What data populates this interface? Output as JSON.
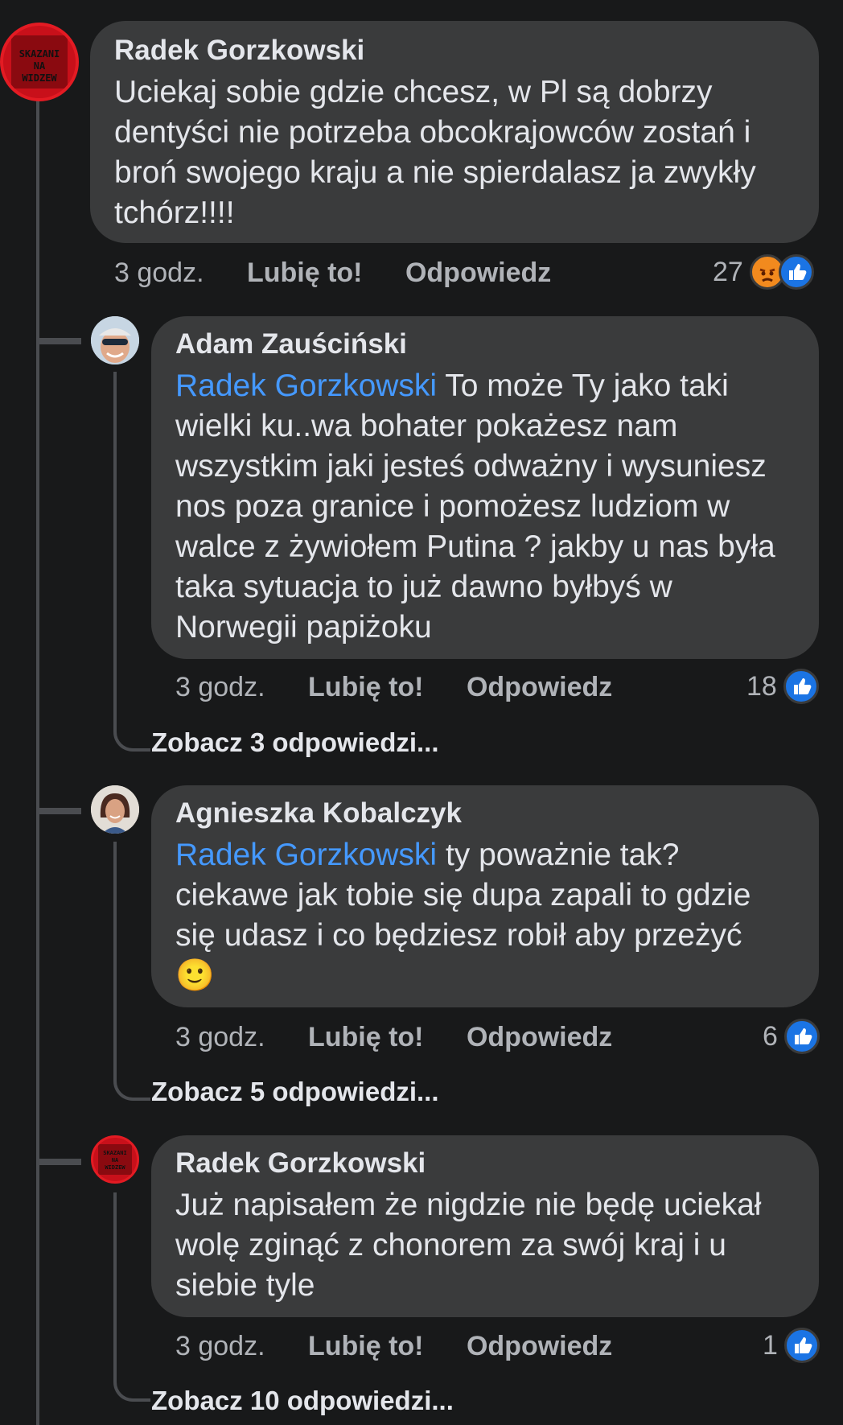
{
  "comments": [
    {
      "author": "Radek Gorzkowski",
      "text": "Uciekaj sobie gdzie chcesz, w Pl są dobrzy dentyści nie potrzeba  obcokrajowców zostań i broń swojego kraju a nie spierdalasz ja zwykły tchórz!!!!",
      "time": "3 godz.",
      "like": "Lubię to!",
      "reply": "Odpowiedz",
      "reactions": "27",
      "logo_lines": [
        "SKAZANI",
        "NA",
        "WIDZEW"
      ]
    },
    {
      "author": "Adam Zauściński",
      "mention": "Radek Gorzkowski",
      "text": " To może Ty jako taki wielki ku..wa bohater pokażesz nam wszystkim jaki jesteś odważny i wysuniesz nos poza granice i pomożesz ludziom w walce z żywiołem Putina ? jakby u nas była taka sytuacja to już dawno byłbyś w Norwegii papiżoku",
      "time": "3 godz.",
      "like": "Lubię to!",
      "reply": "Odpowiedz",
      "reactions": "18",
      "see_replies": "Zobacz 3 odpowiedzi..."
    },
    {
      "author": "Agnieszka Kobalczyk",
      "mention": "Radek Gorzkowski",
      "text": " ty poważnie tak? ciekawe jak tobie się dupa zapali to gdzie się udasz i co będziesz robił aby przeżyć",
      "emoji": "🙂",
      "time": "3 godz.",
      "like": "Lubię to!",
      "reply": "Odpowiedz",
      "reactions": "6",
      "see_replies": "Zobacz 5 odpowiedzi..."
    },
    {
      "author": "Radek Gorzkowski",
      "text": "Już napisałem że nigdzie nie będę uciekał wolę  zginąć z chonorem za swój kraj i u siebie tyle",
      "time": "3 godz.",
      "like": "Lubię to!",
      "reply": "Odpowiedz",
      "reactions": "1",
      "see_replies": "Zobacz 10 odpowiedzi..."
    }
  ],
  "colors": {
    "background": "#18191a",
    "bubble": "#3a3b3c",
    "mention": "#4599ff",
    "like": "#1b74e4",
    "angry": "#f28a1e"
  }
}
